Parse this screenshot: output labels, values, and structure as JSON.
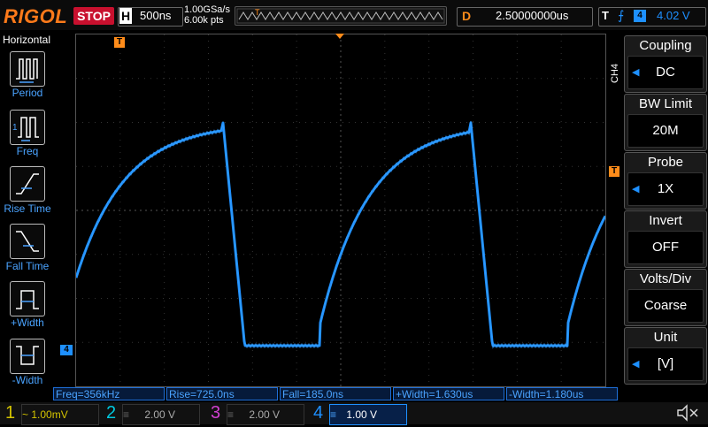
{
  "header": {
    "brand": "RIGOL",
    "run_state": "STOP",
    "timebase_label": "H",
    "timebase_value": "500ns",
    "sample_rate": "1.00GSa/s",
    "mem_depth": "6.00k pts",
    "delay_label": "D",
    "delay_value": "2.50000000us",
    "trigger_label": "T",
    "trigger_edge": "⨍",
    "trigger_source": "4",
    "trigger_level": "4.02 V"
  },
  "left_panel": {
    "title": "Horizontal",
    "items": [
      {
        "label": "Period"
      },
      {
        "label": "Freq"
      },
      {
        "label": "Rise Time"
      },
      {
        "label": "Fall Time"
      },
      {
        "label": "+Width"
      },
      {
        "label": "-Width"
      }
    ]
  },
  "right_menu": {
    "channel": "CH4",
    "items": [
      {
        "header": "Coupling",
        "value": "DC"
      },
      {
        "header": "BW Limit",
        "value": "20M"
      },
      {
        "header": "Probe",
        "value": "1X"
      },
      {
        "header": "Invert",
        "value": "OFF"
      },
      {
        "header": "Volts/Div",
        "value": "Coarse"
      },
      {
        "header": "Unit",
        "value": "[V]"
      }
    ]
  },
  "measurements": [
    "Freq=356kHz",
    "Rise=725.0ns",
    "Fall=185.0ns",
    "+Width=1.630us",
    "-Width=1.180us"
  ],
  "channels": [
    {
      "num": "1",
      "coupling": "~",
      "scale": "1.00mV",
      "color": "#d4c400",
      "active": false
    },
    {
      "num": "2",
      "coupling": "≡",
      "scale": "2.00 V",
      "color": "#00c8e0",
      "active": false
    },
    {
      "num": "3",
      "coupling": "≡",
      "scale": "2.00 V",
      "color": "#d040d0",
      "active": false
    },
    {
      "num": "4",
      "coupling": "≡",
      "scale": "1.00 V",
      "color": "#1e90ff",
      "active": true
    }
  ],
  "markers": {
    "trigger_pos": "T",
    "level_marker": "T",
    "ch4_ground": "4"
  },
  "colors": {
    "accent": "#ff8c1a",
    "trace": "#1e90ff",
    "stop": "#c8102e"
  }
}
